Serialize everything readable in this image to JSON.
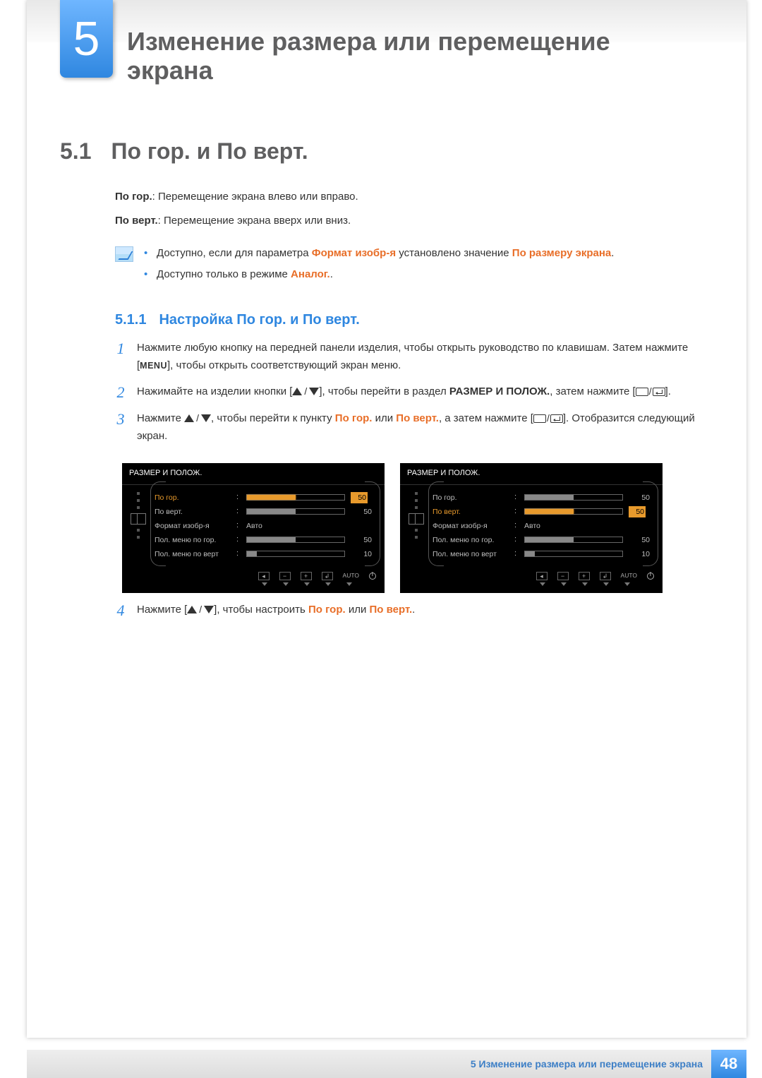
{
  "chapter": {
    "number": "5",
    "title": "Изменение размера или перемещение экрана"
  },
  "section": {
    "number": "5.1",
    "title": "По гор. и По верт."
  },
  "paragraphs": {
    "p1_label": "По гор.",
    "p1_text": ": Перемещение экрана влево или вправо.",
    "p2_label": "По верт.",
    "p2_text": ": Перемещение экрана вверх или вниз."
  },
  "notes": {
    "n1_pre": "Доступно, если для параметра ",
    "n1_h1": "Формат изобр-я",
    "n1_mid": " установлено значение ",
    "n1_h2": "По размеру экрана",
    "n1_post": ".",
    "n2_pre": "Доступно только в режиме ",
    "n2_h1": "Аналог.",
    "n2_post": "."
  },
  "subsection": {
    "number": "5.1.1",
    "title": "Настройка По гор. и По верт."
  },
  "steps": {
    "s1a": "Нажмите любую кнопку на передней панели изделия, чтобы открыть руководство по клавишам. Затем нажмите [",
    "s1_menu": "MENU",
    "s1b": "], чтобы открыть соответствующий экран меню.",
    "s2a": "Нажимайте на изделии кнопки [",
    "s2b": "], чтобы перейти в раздел ",
    "s2_h": "РАЗМЕР И ПОЛОЖ.",
    "s2c": ", затем нажмите [",
    "s2d": "].",
    "s3a": "Нажмите ",
    "s3b": ", чтобы перейти к пункту ",
    "s3_h1": "По гор.",
    "s3_mid": " или ",
    "s3_h2": "По верт.",
    "s3c": ", а затем нажмите [",
    "s3d": "]. Отобразится следующий экран.",
    "s4a": "Нажмите [",
    "s4b": "], чтобы настроить ",
    "s4_h1": "По гор.",
    "s4_mid": " или ",
    "s4_h2": "По верт.",
    "s4_post": "."
  },
  "osd": {
    "title": "РАЗМЕР И ПОЛОЖ.",
    "rows": {
      "r1": "По гор.",
      "r2": "По верт.",
      "r3": "Формат изобр-я",
      "r4": "Пол. меню по гор.",
      "r5": "Пол. меню по верт"
    },
    "auto": "Авто",
    "vals": {
      "v50": "50",
      "v10": "10"
    },
    "bottom": {
      "auto": "AUTO"
    }
  },
  "footer": {
    "text": "5 Изменение размера или перемещение экрана",
    "page": "48"
  }
}
